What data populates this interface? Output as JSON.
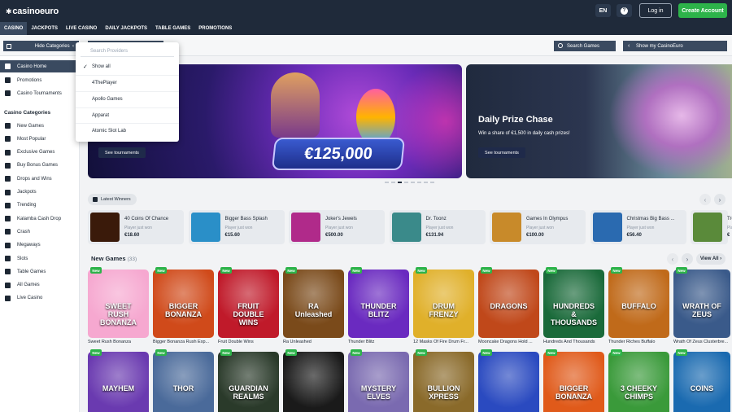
{
  "header": {
    "logo": "casinoeuro",
    "lang": "EN",
    "login": "Log in",
    "create_account": "Create Account"
  },
  "nav": [
    "CASINO",
    "JACKPOTS",
    "LIVE CASINO",
    "DAILY JACKPOTS",
    "TABLE GAMES",
    "PROMOTIONS"
  ],
  "filters": {
    "hide_categories": "Hide Categories",
    "search_games": "Search Games",
    "show_my": "Show my CasinoEuro"
  },
  "providers_dropdown": {
    "placeholder": "Search Providers",
    "options": [
      "Show all",
      "4ThePlayer",
      "Apollo Games",
      "Apparat",
      "Atomic Slot Lab"
    ],
    "selected": "Show all"
  },
  "sidebar": {
    "top_items": [
      "Casino Home",
      "Promotions",
      "Casino Tournaments"
    ],
    "heading": "Casino Categories",
    "categories": [
      "New Games",
      "Most Popular",
      "Exclusive Games",
      "Buy Bonus Games",
      "Drops and Wins",
      "Jackpots",
      "Trending",
      "Kalamba Cash Drop",
      "Crash",
      "Megaways",
      "Slots",
      "Table Games",
      "All Games",
      "Live Casino"
    ]
  },
  "banners": [
    {
      "amount": "€125,000",
      "button": "See tournaments"
    },
    {
      "title": "Daily Prize Chase",
      "subtitle": "Win a share of €1,500 in daily cash prizes!",
      "button": "See tournaments"
    }
  ],
  "latest_winners": {
    "label": "Latest Winners",
    "items": [
      {
        "game": "40 Coins Of Chance",
        "note": "Player just won",
        "amount": "€18.60",
        "color": "#3a1a0a"
      },
      {
        "game": "Bigger Bass Splash",
        "note": "Player just won",
        "amount": "€15.60",
        "color": "#2a8fc8"
      },
      {
        "game": "Joker's Jewels",
        "note": "Player just won",
        "amount": "€500.00",
        "color": "#b02a8a"
      },
      {
        "game": "Dr. Toonz",
        "note": "Player just won",
        "amount": "€131.94",
        "color": "#3a8a8a"
      },
      {
        "game": "Games In Olympus",
        "note": "Player just won",
        "amount": "€100.00",
        "color": "#c88a2a"
      },
      {
        "game": "Christmas Big Bass ...",
        "note": "Player just won",
        "amount": "€56.40",
        "color": "#2a6ab0"
      },
      {
        "game": "Tro",
        "note": "Player just won",
        "amount": "€",
        "color": "#5a8a3a"
      }
    ]
  },
  "new_games": {
    "title": "New Games",
    "count": "(33)",
    "view_all": "View All",
    "badge": "New",
    "row1": [
      {
        "name": "Sweet Rush Bonanza",
        "art": "SWEET RUSH BONANZA",
        "color": "#f6a8d0"
      },
      {
        "name": "Bigger Bonanza Rush Exp...",
        "art": "BIGGER BONANZA",
        "color": "#d04a1a"
      },
      {
        "name": "Fruit Double Wins",
        "art": "FRUIT DOUBLE WINS",
        "color": "#c01a2a"
      },
      {
        "name": "Ra Unleashed",
        "art": "RA Unleashed",
        "color": "#7a4a1a"
      },
      {
        "name": "Thunder Blitz",
        "art": "THUNDER BLITZ",
        "color": "#6a2ac0"
      },
      {
        "name": "12 Masks Of Fire Drum Fr...",
        "art": "DRUM FRENZY",
        "color": "#e0b02a"
      },
      {
        "name": "Mooncake Dragons Hold ...",
        "art": "DRAGONS",
        "color": "#c0481a"
      },
      {
        "name": "Hundreds And Thousands",
        "art": "HUNDREDS & THOUSANDS",
        "color": "#1a6a3a"
      },
      {
        "name": "Thunder Riches Buffalo",
        "art": "BUFFALO",
        "color": "#c06a1a"
      },
      {
        "name": "Wrath Of Zeus Clusterbre...",
        "art": "WRATH OF ZEUS",
        "color": "#3a5a8a"
      }
    ],
    "row2": [
      {
        "art": "MAYHEM",
        "color": "#6a3ab0"
      },
      {
        "art": "THOR",
        "color": "#4a6a9a"
      },
      {
        "art": "GUARDIAN REALMS",
        "color": "#2a3a2a"
      },
      {
        "art": "",
        "color": "#1a1a1a"
      },
      {
        "art": "MYSTERY ELVES",
        "color": "#7a6ab0"
      },
      {
        "art": "BULLION XPRESS",
        "color": "#8a6a2a"
      },
      {
        "art": "",
        "color": "#2a4ac0"
      },
      {
        "art": "BIGGER BONANZA",
        "color": "#e05a1a"
      },
      {
        "art": "3 CHEEKY CHIMPS",
        "color": "#3a9a3a"
      },
      {
        "art": "COINS",
        "color": "#1a6ab0"
      }
    ]
  }
}
